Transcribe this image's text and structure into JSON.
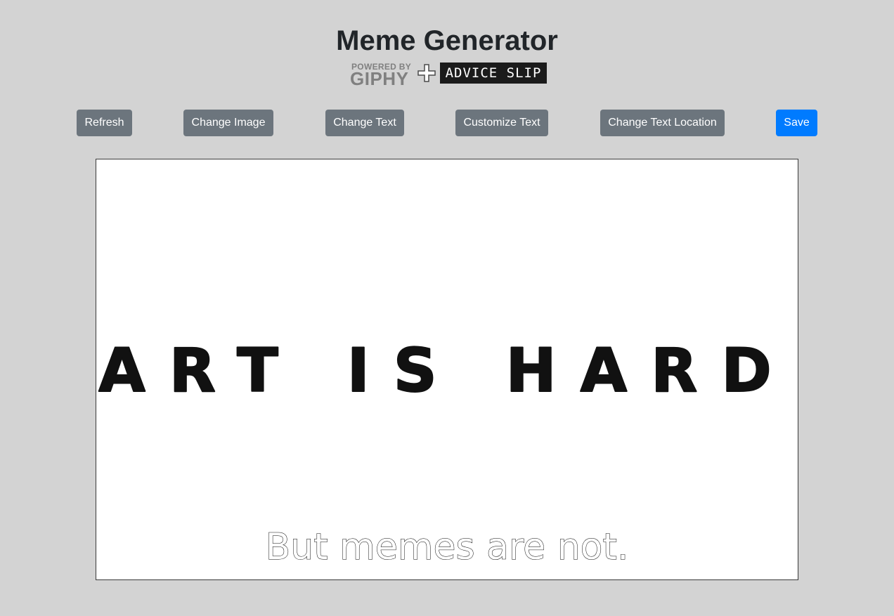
{
  "header": {
    "title": "Meme Generator",
    "logos": {
      "giphy_small": "POWERED BY",
      "giphy_big": "GIPHY",
      "advice": "ADVICE SLIP"
    }
  },
  "toolbar": {
    "refresh_label": "Refresh",
    "change_image_label": "Change Image",
    "change_text_label": "Change Text",
    "customize_text_label": "Customize Text",
    "change_location_label": "Change Text Location",
    "save_label": "Save"
  },
  "meme": {
    "image_text": "ART IS HARD",
    "caption": "But memes are not."
  },
  "colors": {
    "background": "#d3d3d3",
    "secondary_button": "#6c757d",
    "primary_button": "#007bff",
    "title": "#212529"
  }
}
